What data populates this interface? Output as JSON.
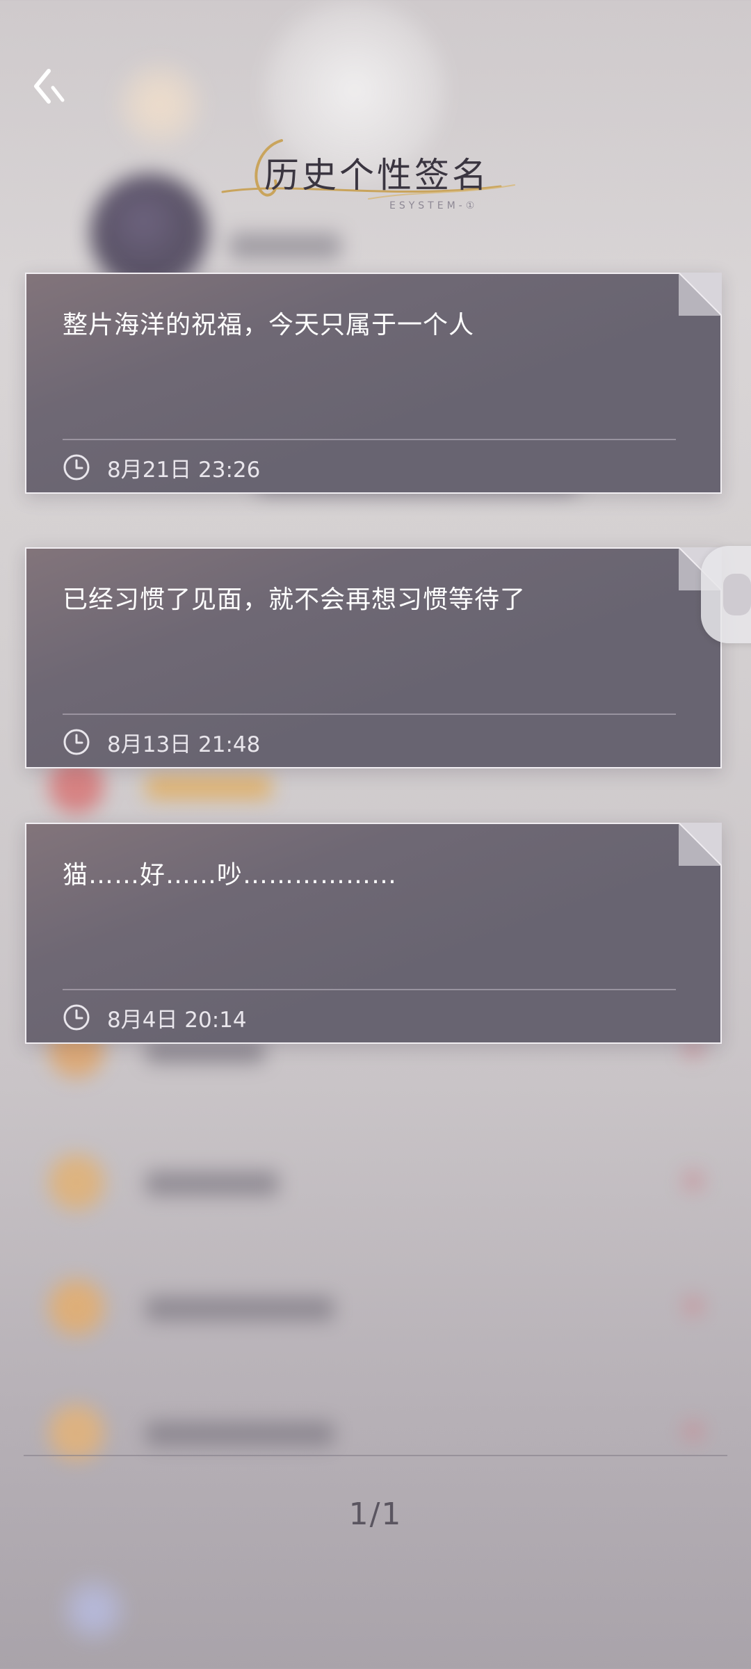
{
  "header": {
    "title": "历史个性签名",
    "subtitle": "ESYSTEM-①"
  },
  "signatures": [
    {
      "text": "整片海洋的祝福，今天只属于一个人",
      "time": "8月21日 23:26"
    },
    {
      "text": "已经习惯了见面，就不会再想习惯等待了",
      "time": "8月13日 21:48"
    },
    {
      "text": "猫……好……吵………………",
      "time": "8月4日 20:14"
    }
  ],
  "pager": {
    "label": "1/1"
  },
  "icons": {
    "back": "chevron-left-icon",
    "clock": "clock-icon",
    "fold": "page-fold-corner"
  },
  "colors": {
    "card_bg": "#6a6672",
    "card_border": "#f1eef2",
    "title_gold": "#c9a45c",
    "title_text": "#3a3540",
    "pager_text": "#5a5560"
  }
}
